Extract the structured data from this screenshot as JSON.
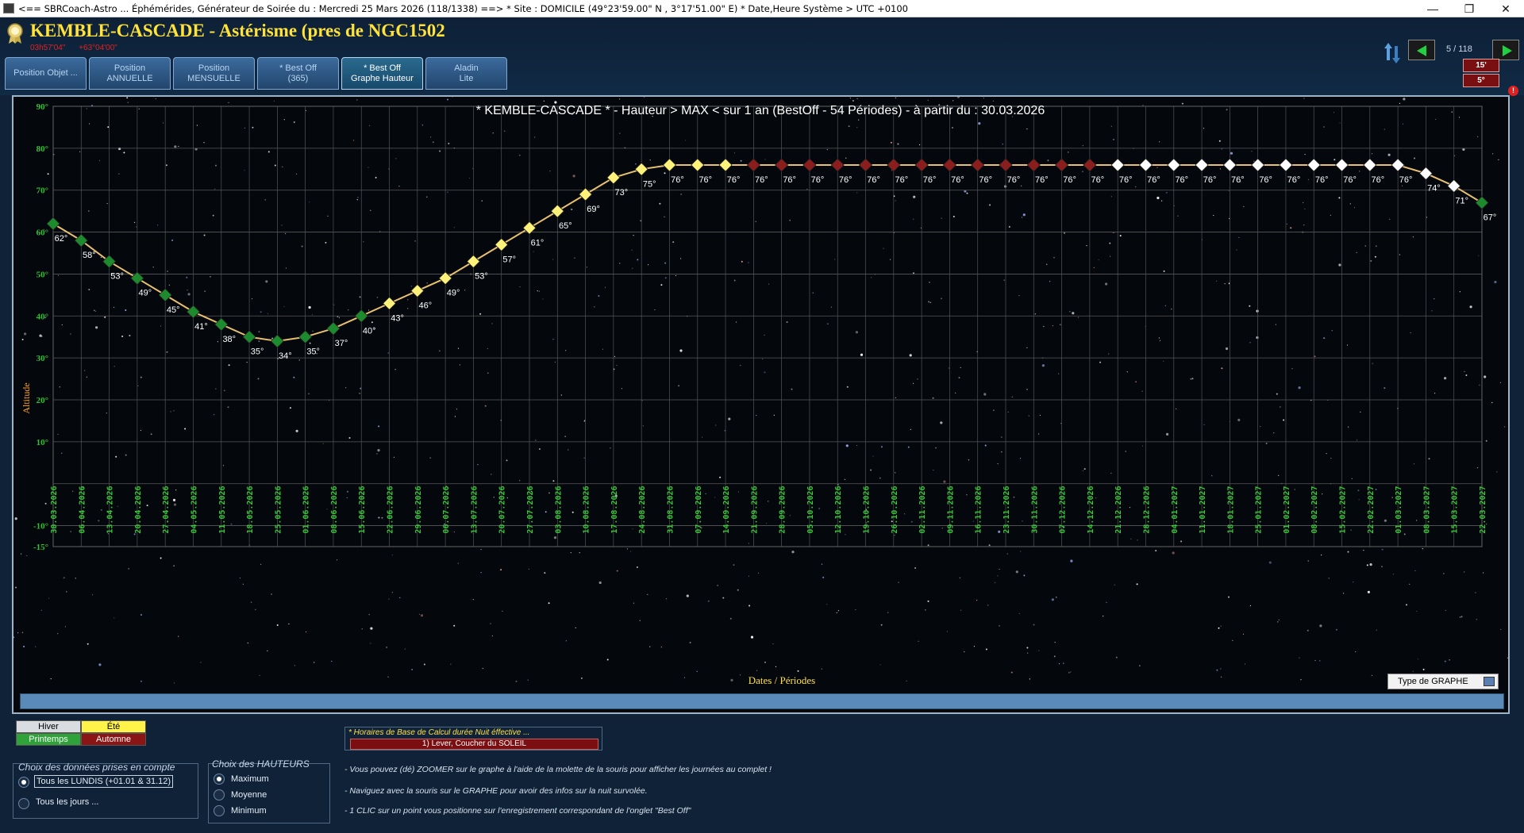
{
  "window": {
    "title": "<== SBRCoach-Astro ... Éphémérides, Générateur de Soirée du : Mercredi 25 Mars 2026  (118/1338) ==> * Site : DOMICILE (49°23'59.00\" N , 3°17'51.00\" E)  * Date,Heure Système > UTC +0100",
    "minimize": "—",
    "restore": "❐",
    "close": "✕"
  },
  "header": {
    "object_title": "KEMBLE-CASCADE - Astérisme (pres de NGC1502",
    "ra": "03h57'04\"",
    "dec": "+63°04'00\"",
    "page_counter": "5 / 118",
    "badge_top": "15'",
    "badge_bottom": "5°",
    "alert": "!"
  },
  "tabs": [
    {
      "l1": "Position Objet ...",
      "l2": ""
    },
    {
      "l1": "Position",
      "l2": "ANNUELLE"
    },
    {
      "l1": "Position",
      "l2": "MENSUELLE"
    },
    {
      "l1": "* Best Off",
      "l2": "(365)"
    },
    {
      "l1": "* Best Off",
      "l2": "Graphe Hauteur"
    },
    {
      "l1": "Aladin",
      "l2": "Lite"
    }
  ],
  "graph_type_button": "Type de GRAPHE",
  "chart_data": {
    "type": "line",
    "title": "* KEMBLE-CASCADE * - Hauteur > MAX < sur 1 an (BestOff - 54 Périodes) - à partir du : 30.03.2026",
    "xlabel": "Dates / Périodes",
    "ylabel": "Altitude",
    "ylim": [
      -15,
      90
    ],
    "yticks": [
      "90°",
      "80°",
      "70°",
      "60°",
      "50°",
      "40°",
      "30°",
      "20°",
      "10°",
      "-10°",
      "-15°"
    ],
    "grid": true,
    "x": [
      "30.03.2026",
      "06.04.2026",
      "13.04.2026",
      "20.04.2026",
      "27.04.2026",
      "04.05.2026",
      "11.05.2026",
      "18.05.2026",
      "25.05.2026",
      "01.06.2026",
      "08.06.2026",
      "15.06.2026",
      "22.06.2026",
      "29.06.2026",
      "06.07.2026",
      "13.07.2026",
      "20.07.2026",
      "27.07.2026",
      "03.08.2026",
      "10.08.2026",
      "17.08.2026",
      "24.08.2026",
      "31.08.2026",
      "07.09.2026",
      "14.09.2026",
      "21.09.2026",
      "28.09.2026",
      "05.10.2026",
      "12.10.2026",
      "19.10.2026",
      "26.10.2026",
      "02.11.2026",
      "09.11.2026",
      "16.11.2026",
      "23.11.2026",
      "30.11.2026",
      "07.12.2026",
      "14.12.2026",
      "21.12.2026",
      "28.12.2026",
      "04.01.2027",
      "11.01.2027",
      "18.01.2027",
      "25.01.2027",
      "01.02.2027",
      "08.02.2027",
      "15.02.2027",
      "22.02.2027",
      "01.03.2027",
      "08.03.2027",
      "15.03.2027",
      "22.03.2027"
    ],
    "values": [
      62,
      58,
      53,
      49,
      45,
      41,
      38,
      35,
      34,
      35,
      37,
      40,
      43,
      46,
      49,
      53,
      57,
      61,
      65,
      69,
      73,
      75,
      76,
      76,
      76,
      76,
      76,
      76,
      76,
      76,
      76,
      76,
      76,
      76,
      76,
      76,
      76,
      76,
      76,
      76,
      76,
      76,
      76,
      76,
      76,
      76,
      76,
      76,
      76,
      74,
      71,
      67
    ],
    "labels": [
      "62°",
      "58°",
      "53°",
      "49°",
      "45°",
      "41°",
      "38°",
      "35°",
      "34°",
      "35°",
      "37°",
      "40°",
      "43°",
      "46°",
      "49°",
      "53°",
      "57°",
      "61°",
      "65°",
      "69°",
      "73°",
      "75°",
      "76°",
      "76°",
      "76°",
      "76°",
      "76°",
      "76°",
      "76°",
      "76°",
      "76°",
      "76°",
      "76°",
      "76°",
      "76°",
      "76°",
      "76°",
      "76°",
      "76°",
      "76°",
      "76°",
      "76°",
      "76°",
      "76°",
      "76°",
      "76°",
      "76°",
      "76°",
      "76°",
      "74°",
      "71°",
      "67°"
    ],
    "seasons": [
      "printemps",
      "printemps",
      "printemps",
      "printemps",
      "printemps",
      "printemps",
      "printemps",
      "printemps",
      "printemps",
      "printemps",
      "printemps",
      "printemps",
      "ete",
      "ete",
      "ete",
      "ete",
      "ete",
      "ete",
      "ete",
      "ete",
      "ete",
      "ete",
      "ete",
      "ete",
      "ete",
      "automne",
      "automne",
      "automne",
      "automne",
      "automne",
      "automne",
      "automne",
      "automne",
      "automne",
      "automne",
      "automne",
      "automne",
      "automne",
      "hiver",
      "hiver",
      "hiver",
      "hiver",
      "hiver",
      "hiver",
      "hiver",
      "hiver",
      "hiver",
      "hiver",
      "hiver",
      "hiver",
      "hiver",
      "printemps"
    ],
    "season_colors": {
      "printemps": "#1e8a2e",
      "ete": "#fff27a",
      "automne": "#8b1d1d",
      "hiver": "#ffffff"
    },
    "line_color": "#e8c070",
    "date_label_color": "#39c839"
  },
  "legend": {
    "hiver": "Hiver",
    "ete": "Été",
    "printemps": "Printemps",
    "automne": "Automne"
  },
  "choix_donnees": {
    "title": "Choix des données prises en compte",
    "opt1": "Tous les LUNDIS (+01.01 & 31.12)",
    "opt2": "Tous les jours ..."
  },
  "choix_hauteurs": {
    "title": "Choix des HAUTEURS",
    "opt1": "Maximum",
    "opt2": "Moyenne",
    "opt3": "Minimum"
  },
  "horaires": {
    "title": "* Horaires de Base de Calcul durée Nuit éffective ...",
    "value": "1) Lever, Coucher du SOLEIL"
  },
  "notes": [
    "- Vous pouvez (dé) ZOOMER sur le graphe à l'aide de la molette de la souris pour afficher les journées au complet !",
    "- Naviguez avec la souris sur le GRAPHE pour avoir des infos sur la nuit survolée.",
    "- 1 CLIC sur un point vous positionne sur l'enregistrement correspondant de l'onglet \"Best Off\""
  ]
}
